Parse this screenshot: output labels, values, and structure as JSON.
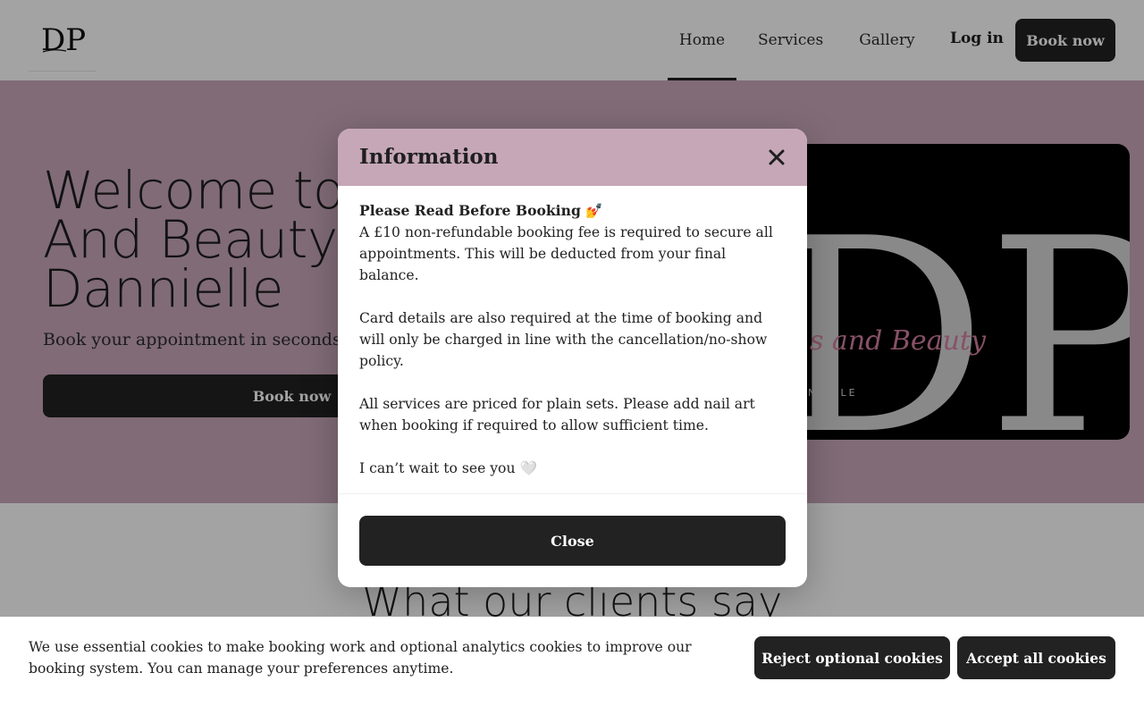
{
  "header": {
    "logo_text": "DP",
    "nav": [
      {
        "label": "Home",
        "active": true
      },
      {
        "label": "Services",
        "active": false
      },
      {
        "label": "Gallery",
        "active": false
      }
    ],
    "login_label": "Log in",
    "book_label": "Book now"
  },
  "hero": {
    "title": "Welcome to\nAnd Beauty\nDannielle",
    "subtitle": "Book your appointment in seconds",
    "book_label": "Book now",
    "image_logo": {
      "monogram": "DP",
      "script_text": "s and Beauty",
      "small_text": "NIELLE"
    }
  },
  "reviews": {
    "title": "What our clients say"
  },
  "modal": {
    "title": "Information",
    "heading": "Please Read Before Booking 💅",
    "paragraphs": [
      "A £10 non-refundable booking fee is required to secure all appointments. This will be deducted from your final balance.",
      "Card details are also required at the time of booking and will only be charged in line with the cancellation/no-show policy.",
      "All services are priced for plain sets. Please add nail art when booking if required to allow sufficient time.",
      "I can’t wait to see you 🤍"
    ],
    "close_label": "Close"
  },
  "cookie": {
    "text": "We use essential cookies to make booking work and optional analytics cookies to improve our booking system. You can manage your preferences anytime.",
    "reject_label": "Reject optional cookies",
    "accept_label": "Accept all cookies"
  },
  "colors": {
    "hero_bg": "#c8a8ba",
    "modal_header": "#c6a7b7",
    "button_dark": "#222222",
    "script_pink": "#d47fa0"
  },
  "icons": {
    "close": "close-icon"
  }
}
